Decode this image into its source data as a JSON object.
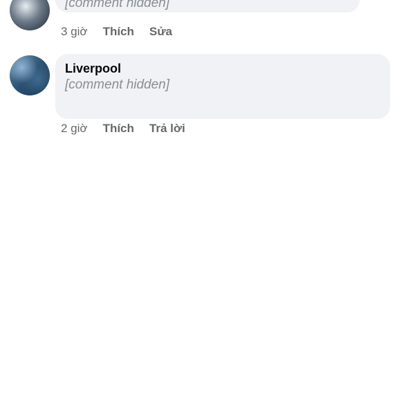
{
  "comments": [
    {
      "message_placeholder": "[comment hidden]",
      "time": "3 giờ",
      "actions": [
        "Thích",
        "Sửa"
      ]
    },
    {
      "author": "Liverpool",
      "message_placeholder": "[comment hidden]",
      "time": "2 giờ",
      "actions": [
        "Thích",
        "Trả lời"
      ]
    }
  ],
  "colors": {
    "bubble_bg": "#f0f2f5",
    "meta_text": "#65676b",
    "body_text": "#050505"
  }
}
